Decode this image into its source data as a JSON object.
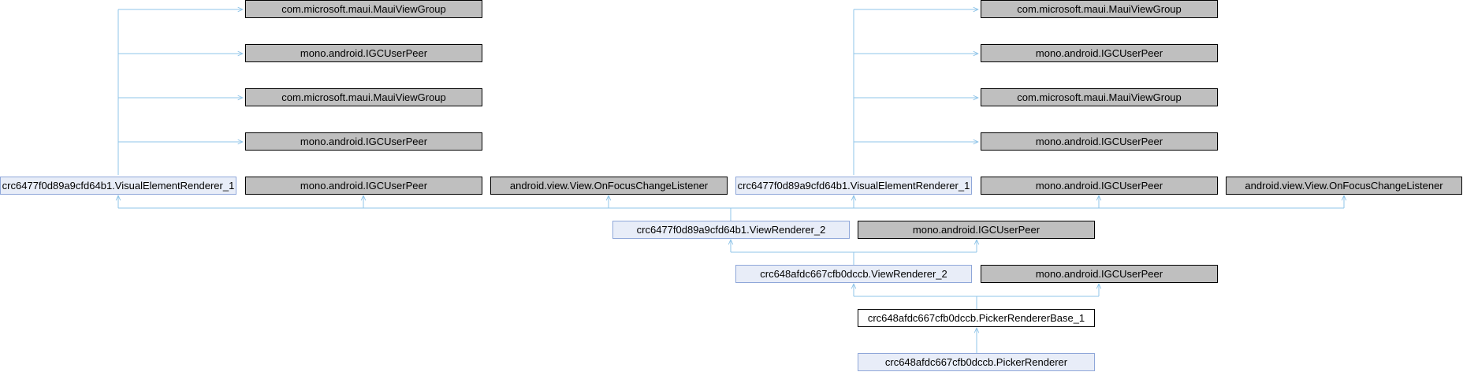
{
  "diagram": {
    "nodes": {
      "n1": "com.microsoft.maui.MauiViewGroup",
      "n2": "mono.android.IGCUserPeer",
      "n3": "com.microsoft.maui.MauiViewGroup",
      "n4": "mono.android.IGCUserPeer",
      "n5": "com.microsoft.maui.MauiViewGroup",
      "n6": "mono.android.IGCUserPeer",
      "n7": "com.microsoft.maui.MauiViewGroup",
      "n8": "mono.android.IGCUserPeer",
      "n9": "crc6477f0d89a9cfd64b1.VisualElementRenderer_1",
      "n10": "mono.android.IGCUserPeer",
      "n11": "android.view.View.OnFocusChangeListener",
      "n12": "crc6477f0d89a9cfd64b1.VisualElementRenderer_1",
      "n13": "mono.android.IGCUserPeer",
      "n14": "android.view.View.OnFocusChangeListener",
      "n15": "crc6477f0d89a9cfd64b1.ViewRenderer_2",
      "n16": "mono.android.IGCUserPeer",
      "n17": "crc648afdc667cfb0dccb.ViewRenderer_2",
      "n18": "mono.android.IGCUserPeer",
      "n19": "crc648afdc667cfb0dccb.PickerRendererBase_1",
      "n20": "crc648afdc667cfb0dccb.PickerRenderer"
    },
    "colors": {
      "edge": "#8fc4e8",
      "gray_fill": "#bfbfbf",
      "blue_fill": "#e8edf8",
      "blue_border": "#8fa7d9"
    }
  }
}
